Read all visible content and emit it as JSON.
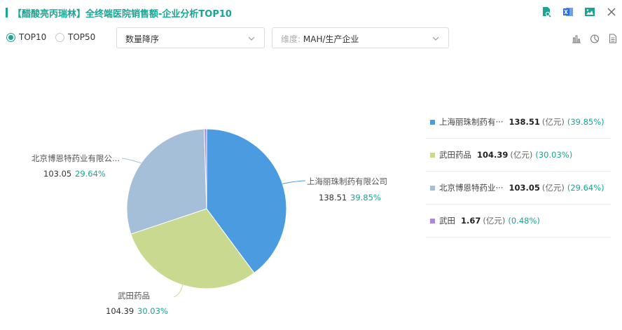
{
  "header": {
    "title": "【醋酸亮丙瑞林】全终端医院销售额-企业分析TOP10"
  },
  "controls": {
    "radios": [
      {
        "label": "TOP10",
        "checked": true
      },
      {
        "label": "TOP50",
        "checked": false
      }
    ],
    "sort_select": {
      "value": "数量降序"
    },
    "dimension_select": {
      "prefix": "维度:",
      "value": "MAH/生产企业"
    }
  },
  "colors": {
    "accent": "#1aa493"
  },
  "chart_data": {
    "type": "pie",
    "unit": "(亿元)",
    "slices": [
      {
        "label": "上海丽珠制药有限公司",
        "legend_label": "上海丽珠制药有···",
        "value": 138.51,
        "value_text": "138.51",
        "percent": "39.85%",
        "color": "#4a9be0"
      },
      {
        "label": "武田药品",
        "legend_label": "武田药品",
        "value": 104.39,
        "value_text": "104.39",
        "percent": "30.03%",
        "color": "#c9d98f"
      },
      {
        "label": "北京博恩特药业有限公...",
        "legend_label": "北京博恩特药业···",
        "value": 103.05,
        "value_text": "103.05",
        "percent": "29.64%",
        "color": "#a5bfd8"
      },
      {
        "label": "武田",
        "legend_label": "武田",
        "value": 1.67,
        "value_text": "1.67",
        "percent": "0.48%",
        "color": "#a78ae0"
      }
    ]
  }
}
